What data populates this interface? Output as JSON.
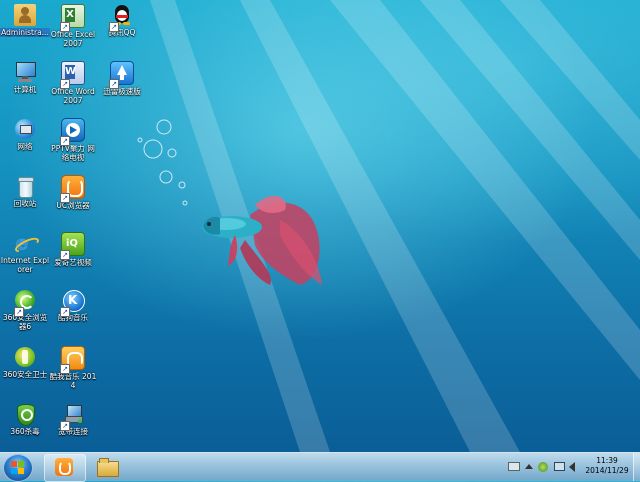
{
  "desktop": {
    "icons": [
      {
        "label": "Administra...",
        "icon": "user-folder-icon"
      },
      {
        "label": "Office Excel 2007",
        "icon": "excel-icon"
      },
      {
        "label": "腾讯QQ",
        "icon": "qq-penguin-icon"
      },
      {
        "label": "计算机",
        "icon": "computer-icon"
      },
      {
        "label": "Office Word 2007",
        "icon": "word-icon"
      },
      {
        "label": "迅雷极速版",
        "icon": "thunder-icon"
      },
      {
        "label": "网络",
        "icon": "network-icon"
      },
      {
        "label": "PPTV聚力 网络电视",
        "icon": "pptv-icon"
      },
      {
        "label": "回收站",
        "icon": "recycle-bin-icon"
      },
      {
        "label": "UC浏览器",
        "icon": "uc-browser-icon"
      },
      {
        "label": "Internet Explorer",
        "icon": "ie-icon"
      },
      {
        "label": "爱奇艺视频",
        "icon": "iqiyi-icon"
      },
      {
        "label": "360安全浏览器6",
        "icon": "360-browser-icon"
      },
      {
        "label": "酷狗音乐",
        "icon": "kugou-icon"
      },
      {
        "label": "360安全卫士",
        "icon": "360-safe-icon"
      },
      {
        "label": "酷我音乐 2014",
        "icon": "kuwo-icon"
      },
      {
        "label": "360杀毒",
        "icon": "360-antivirus-icon"
      },
      {
        "label": "宽带连接",
        "icon": "broadband-icon"
      }
    ]
  },
  "taskbar": {
    "pinned": [
      {
        "name": "uc-browser-taskbar-icon"
      },
      {
        "name": "explorer-folder-taskbar-icon"
      }
    ],
    "clock": {
      "time": "11:39",
      "date": "2014/11/29"
    }
  },
  "colors": {
    "desktop_top": "#1aa9cf",
    "desktop_bottom": "#0a5a93",
    "fish_body": "#2bb0c8",
    "fish_fin": "#d43b5a"
  }
}
